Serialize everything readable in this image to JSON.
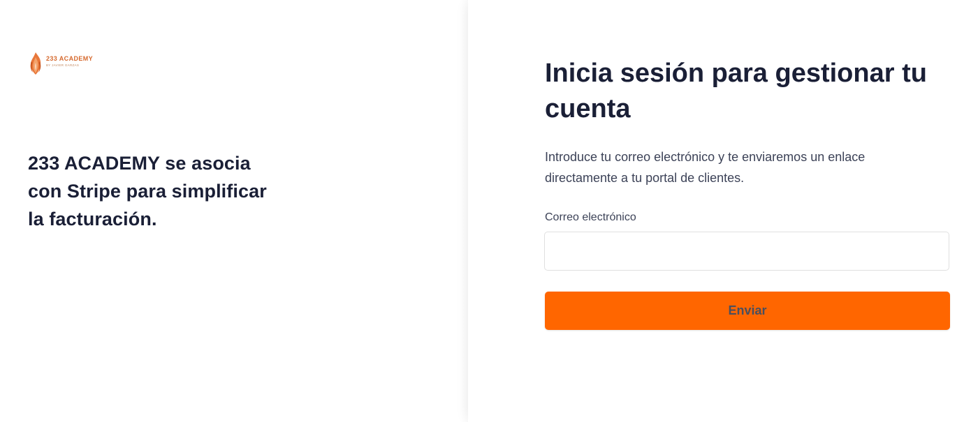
{
  "brand": {
    "name": "233 ACADEMY",
    "subtitle": "BY JAVIER GARZAS",
    "logo_icon": "flame-icon",
    "accent_color": "#d66a2f"
  },
  "left": {
    "tagline": "233 ACADEMY se asocia con Stripe para simplificar la facturación."
  },
  "login": {
    "heading": "Inicia sesión para gestionar tu cuenta",
    "description": "Introduce tu correo electrónico y te enviaremos un enlace directamente a tu portal de clientes.",
    "email_label": "Correo electrónico",
    "email_value": "",
    "email_placeholder": "",
    "submit_label": "Enviar",
    "button_color": "#ff6600"
  }
}
